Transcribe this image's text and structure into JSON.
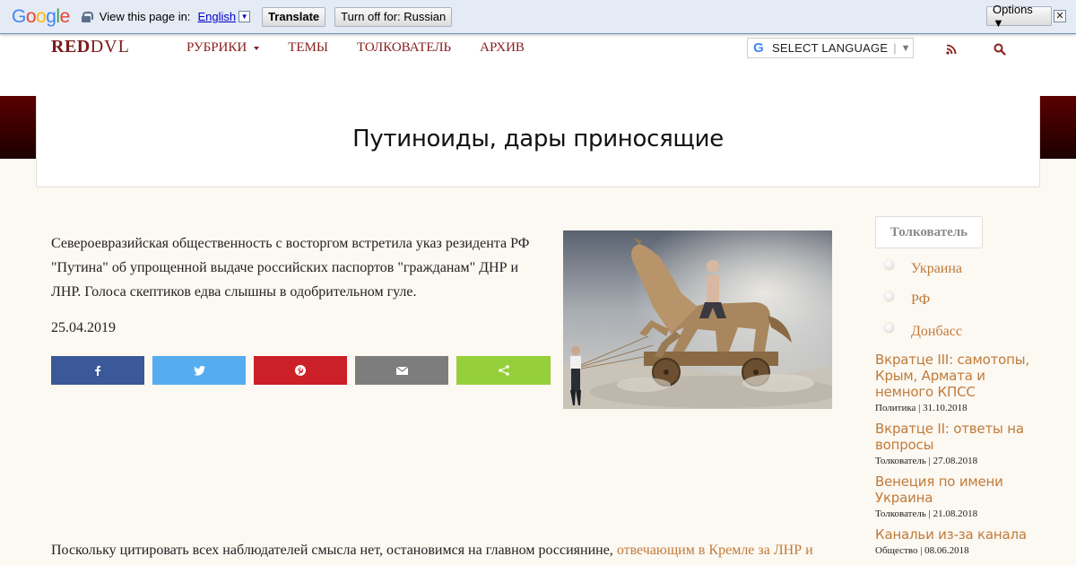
{
  "translate_bar": {
    "logo_letters": [
      "G",
      "o",
      "o",
      "g",
      "l",
      "e"
    ],
    "prompt": "View this page in:",
    "language": "English",
    "translate_label": "Translate",
    "turn_off_label": "Turn off for: Russian",
    "options_label": "Options ▼",
    "close_glyph": "✕"
  },
  "header": {
    "logo_bold": "RED",
    "logo_thin": "DVL",
    "nav": [
      {
        "label": "РУБРИКИ",
        "has_dropdown": true
      },
      {
        "label": "ТЕМЫ",
        "has_dropdown": false
      },
      {
        "label": "ТОЛКОВАТЕЛЬ",
        "has_dropdown": false
      },
      {
        "label": "АРХИВ",
        "has_dropdown": false
      }
    ],
    "select_language": "SELECT LANGUAGE",
    "select_sep": "|",
    "select_arrow": "▼",
    "icons": [
      "rss-icon",
      "search-icon"
    ]
  },
  "colors": {
    "accent": "#c07b3a",
    "nav": "#8a1c1c",
    "band_top": "#5a0000",
    "band_bottom": "#1c0000",
    "facebook": "#3b5998",
    "twitter": "#55acee",
    "pinterest": "#cb2027",
    "email": "#7d7d7d",
    "sharethis": "#95d03a"
  },
  "article": {
    "title": "Путиноиды, дары приносящие",
    "lead": "Североевразийская общественность с восторгом встретила указ резидента РФ \"Путина\" об упрощенной выдаче российских паспортов \"гражданам\" ДНР и ЛНР. Голоса скептиков едва слышны в одобрительном гуле.",
    "date": "25.04.2019",
    "share_buttons": [
      {
        "name": "facebook",
        "icon": "facebook-icon"
      },
      {
        "name": "twitter",
        "icon": "twitter-icon"
      },
      {
        "name": "pinterest",
        "icon": "pinterest-icon"
      },
      {
        "name": "email",
        "icon": "email-icon"
      },
      {
        "name": "sharethis",
        "icon": "share-icon"
      }
    ],
    "body_text": "Поскольку цитировать всех наблюдателей смысла нет, остановимся на главном россиянине, ",
    "body_link": "отвечающим в Кремле за ЛНР и"
  },
  "sidebar": {
    "tab_label": "Толкователь",
    "categories": [
      "Украина",
      "РФ",
      "Донбасс"
    ],
    "posts": [
      {
        "title": "Вкратце III: самотопы, Крым, Армата и немного КПСС",
        "meta": "Политика | 31.10.2018"
      },
      {
        "title": "Вкратце II: ответы на вопросы",
        "meta": "Толкователь | 27.08.2018"
      },
      {
        "title": "Венеция по имени Украина",
        "meta": "Толкователь | 21.08.2018"
      },
      {
        "title": "Канальи из-за канала",
        "meta": "Общество | 08.06.2018"
      }
    ]
  }
}
